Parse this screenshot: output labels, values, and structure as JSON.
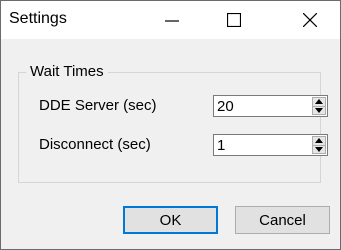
{
  "window": {
    "title": "Settings",
    "minimize_label": "",
    "maximize_label": "",
    "close_label": ""
  },
  "group": {
    "label": "Wait Times"
  },
  "fields": [
    {
      "label": "DDE Server (sec)",
      "value": "20"
    },
    {
      "label": "Disconnect (sec)",
      "value": "1"
    }
  ],
  "buttons": {
    "ok": "OK",
    "cancel": "Cancel"
  },
  "colors": {
    "focus_border": "#0078d7",
    "dialog_bg": "#f0f0f0"
  },
  "icons": [
    "minimize-icon",
    "maximize-icon",
    "close-icon",
    "spin-up-icon",
    "spin-down-icon"
  ]
}
